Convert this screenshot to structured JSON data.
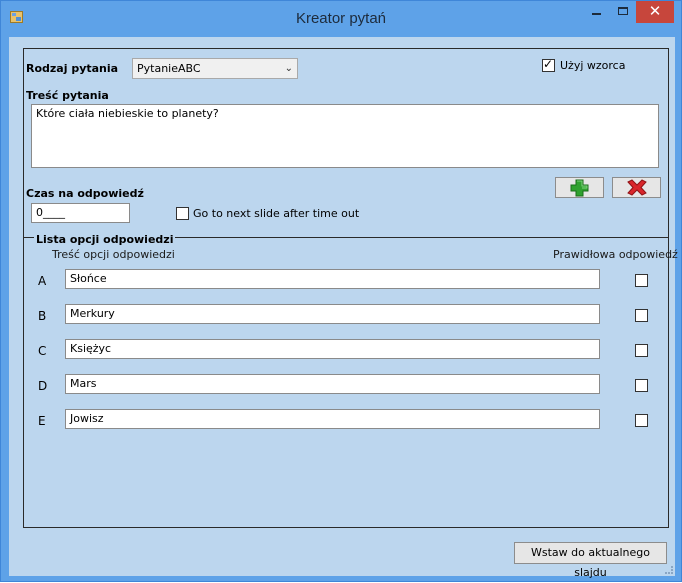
{
  "window": {
    "title": "Kreator pytań",
    "close_glyph": "✕"
  },
  "question_type": {
    "label": "Rodzaj pytania",
    "value": "PytanieABC"
  },
  "use_template": {
    "label": "Użyj wzorca",
    "checked": true
  },
  "question_content": {
    "label": "Treść pytania",
    "value": "Które ciała niebieskie to planety?"
  },
  "answer_time": {
    "label": "Czas na odpowiedź",
    "value": "0____"
  },
  "next_slide": {
    "label": "Go to next slide after time out",
    "checked": false
  },
  "answers_group": {
    "title": "Lista opcji odpowiedzi",
    "content_header": "Treść opcji odpowiedzi",
    "correct_header": "Prawidłowa odpowiedź",
    "options": [
      {
        "letter": "A",
        "text": "Słońce",
        "correct": false
      },
      {
        "letter": "B",
        "text": "Merkury",
        "correct": false
      },
      {
        "letter": "C",
        "text": "Księżyc",
        "correct": false
      },
      {
        "letter": "D",
        "text": "Mars",
        "correct": false
      },
      {
        "letter": "E",
        "text": "Jowisz",
        "correct": false
      }
    ]
  },
  "insert_button": {
    "label": "Wstaw do aktualnego slajdu"
  },
  "icons": {
    "add": "plus-icon",
    "remove": "x-icon"
  },
  "colors": {
    "title_bar": "#5ea2e8",
    "client_bg": "#bcd6ee",
    "close_button": "#c7463c",
    "add_green": "#2fa12f",
    "remove_red": "#d9262b"
  }
}
